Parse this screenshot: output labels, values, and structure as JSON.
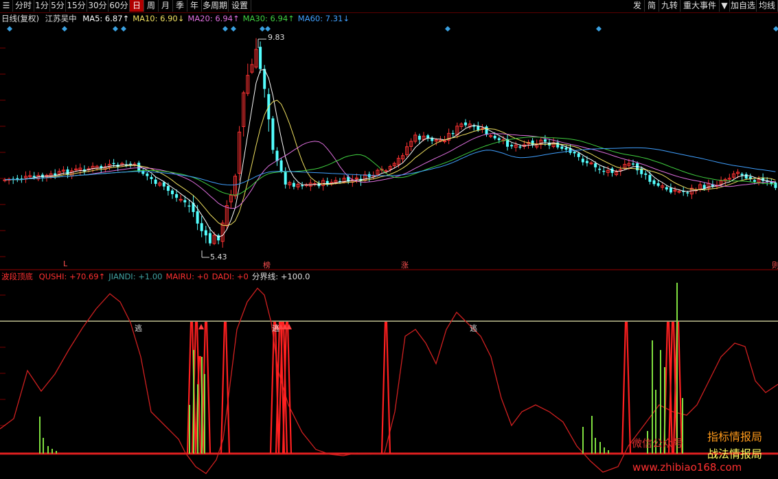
{
  "toolbar": {
    "left_buttons": [
      "分时",
      "1分",
      "5分",
      "15分",
      "30分",
      "60分",
      "日",
      "周",
      "月",
      "季",
      "年",
      "多周期",
      "设置"
    ],
    "active": "日",
    "right_buttons": [
      "发",
      "简",
      "九转",
      "重大事件",
      "▼",
      "加自选",
      "均线"
    ]
  },
  "price_panel": {
    "period": "日线(复权)",
    "stock": "江苏吴中",
    "ma": [
      {
        "label": "MA5: 6.87↑",
        "color": "#ffffff"
      },
      {
        "label": "MA10: 6.90↓",
        "color": "#f0e060"
      },
      {
        "label": "MA20: 6.94↑",
        "color": "#e070e0"
      },
      {
        "label": "MA30: 6.94↑",
        "color": "#40d040"
      },
      {
        "label": "MA60: 7.31↓",
        "color": "#40a0ff"
      }
    ],
    "high_label": "9.83",
    "low_label": "5.43",
    "bottom_markers": [
      {
        "text": "L",
        "color": "#ff5050"
      },
      {
        "text": "榜",
        "color": "#ff5050"
      },
      {
        "text": "涨",
        "color": "#ff5050"
      },
      {
        "text": "则",
        "color": "#ff5050"
      }
    ]
  },
  "indicator_panel": {
    "name": "波段顶底",
    "items": [
      {
        "label": "QUSHI: +70.69↑",
        "color": "#ff3030"
      },
      {
        "label": "JIANDI: +1.00",
        "color": "#40a0a0"
      },
      {
        "label": "MAIRU: +0",
        "color": "#ff3030"
      },
      {
        "label": "DADI: +0",
        "color": "#ff3030"
      },
      {
        "label": "分界线: +100.0",
        "color": "#e0e0e0"
      }
    ],
    "escape_labels": [
      "逃",
      "逃",
      "逃"
    ]
  },
  "watermark": {
    "wechat": "微信公众号",
    "line1": "指标情报局",
    "line2": "战法情报局",
    "url": "www.zhibiao168.com"
  },
  "colors": {
    "up": "#ff3232",
    "down": "#54ffff",
    "grid": "#7a0000",
    "qushi": "#d02020",
    "boundary": "#e8e8b0",
    "jiandi": "#80e040"
  }
}
